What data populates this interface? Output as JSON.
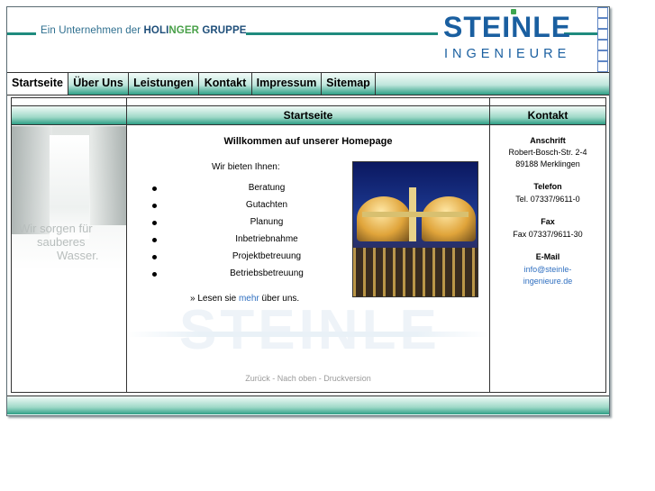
{
  "header": {
    "tagline_prefix": "Ein Unternehmen der",
    "tagline_brand_a": "HOLI",
    "tagline_brand_b": "NGER",
    "tagline_brand_c": "GRUPPE",
    "logo_word": "STEINLE",
    "logo_sub": "INGENIEURE"
  },
  "nav": {
    "items": [
      {
        "label": "Startseite"
      },
      {
        "label": "Über Uns"
      },
      {
        "label": "Leistungen"
      },
      {
        "label": "Kontakt"
      },
      {
        "label": "Impressum"
      },
      {
        "label": "Sitemap"
      }
    ],
    "active_index": 0
  },
  "left": {
    "slogan": [
      "Wir sorgen für",
      "sauberes",
      "Wasser."
    ]
  },
  "main": {
    "heading": "Startseite",
    "welcome": "Willkommen auf unserer Homepage",
    "offer_intro": "Wir bieten Ihnen:",
    "services": [
      "Beratung",
      "Gutachten",
      "Planung",
      "Inbetriebnahme",
      "Projektbetreuung",
      "Betriebsbetreuung"
    ],
    "readmore_prefix": "» Lesen sie",
    "readmore_link": "mehr",
    "readmore_suffix": "über uns.",
    "watermark": "STEINLE",
    "footer": {
      "back": "Zurück",
      "sep1": " - ",
      "top": "Nach oben",
      "sep2": " - ",
      "print": "Druckversion"
    }
  },
  "right": {
    "heading": "Kontakt",
    "address_label": "Anschrift",
    "address_line1": "Robert-Bosch-Str. 2-4",
    "address_line2": "89188 Merklingen",
    "phone_label": "Telefon",
    "phone": "Tel. 07337/9611-0",
    "fax_label": "Fax",
    "fax": "Fax 07337/9611-30",
    "email_label": "E-Mail",
    "email_line1": "info@steinle-",
    "email_line2": "ingenieure.de"
  },
  "colors": {
    "accent_green": "#1f8b7e",
    "brand_blue": "#1a5fa0",
    "link_blue": "#2f6fc0"
  }
}
